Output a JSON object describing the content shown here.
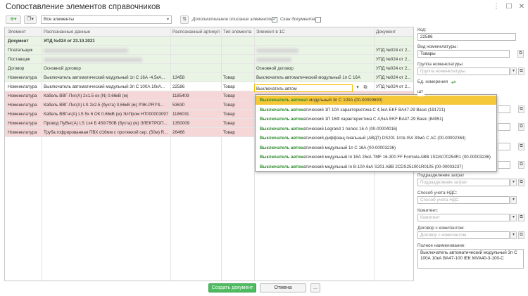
{
  "window": {
    "title": "Сопоставление элементов справочников"
  },
  "toolbar": {
    "filter_value": "Все элементы",
    "additional_descriptions_label": "Дополнительное описание элементов:",
    "scan_label": "Скан документа:"
  },
  "table": {
    "headers": [
      "Элемент",
      "Распознанные данные",
      "Распознанный артикул",
      "Тип элемента",
      "Элемент в 1С",
      "Документ"
    ],
    "rows": [
      {
        "color": "green",
        "element": "Документ",
        "data": "УПД №024 от 23.10.2021",
        "article": "",
        "type": "",
        "elem1c": "",
        "doc": "",
        "bold": true
      },
      {
        "color": "green",
        "element": "Плательщик",
        "data": "",
        "article": "",
        "type": "",
        "elem1c": "",
        "doc": "УПД №024 от 2..."
      },
      {
        "color": "green",
        "element": "Поставщик",
        "data": "",
        "article": "",
        "type": "",
        "elem1c": "",
        "doc": "УПД №024 от 2..."
      },
      {
        "color": "green",
        "element": "Договор",
        "data": "Основной договор",
        "article": "",
        "type": "",
        "elem1c": "Основной договор",
        "doc": "УПД №024 от 2..."
      },
      {
        "color": "green",
        "element": "Номенклатура",
        "data": "Выключатель автоматический модульный 1п С 16А -4,5кА...",
        "article": "13458",
        "type": "Товар",
        "elem1c": "Выключатель автоматический модульный 1п С 16А",
        "doc": "УПД №024 от 2..."
      },
      {
        "color": "white",
        "element": "Номенклатура",
        "data": "Выключатель автоматический модульный 3п С 100А 10кА...",
        "article": "22586",
        "type": "Товар",
        "elem1c": "",
        "doc": "УПД №024 от 2..."
      },
      {
        "color": "pink",
        "element": "Номенклатура",
        "data": "Кабель ВВГ-Пнг(А) 2х1.5 ок (N) 0.66кВ (м)",
        "article": "1185409",
        "type": "Товар",
        "elem1c": "",
        "doc": ""
      },
      {
        "color": "pink",
        "element": "Номенклатура",
        "data": "Кабель ВВГ-Пнг(А) LS 2х2.5 (бухта) 0,66кВ (м) РЭК-PRYS...",
        "article": "53630",
        "type": "Товар",
        "elem1c": "",
        "doc": ""
      },
      {
        "color": "pink",
        "element": "Номенклатура",
        "data": "Кабель ВВГнг(А) LS 5х 6 ОК 0.66кВ (м) ЭлПром НТ000003097",
        "article": "1186031",
        "type": "Товар",
        "elem1c": "",
        "doc": ""
      },
      {
        "color": "pink",
        "element": "Номенклатура",
        "data": "Провод ПуВнг(А) LS 1х4 Б 450/750В (бухта) (м) ЭЛЕКТРОП...",
        "article": "1350009",
        "type": "Товар",
        "elem1c": "",
        "doc": ""
      },
      {
        "color": "pink",
        "element": "Номенклатура",
        "data": "Труба гофрированная ПВХ d16мм с протяжкой сер. (50м) R...",
        "article": "26466",
        "type": "Товар",
        "elem1c": "",
        "doc": ""
      }
    ],
    "editing_value": "Выключатель автом"
  },
  "dropdown": {
    "match": "Выключатель автомат",
    "items": [
      {
        "match": "Выключатель автомат",
        "rest": " модульный 3п С 100А (00-00009690)"
      },
      {
        "match": "Выключатель автом",
        "rest": "атический 1П 10А характеристика С 4,5кА EKF BA47-29 Basic (191721)"
      },
      {
        "match": "Выключатель автом",
        "rest": "атический 1П 16Ф характеристика С 4,5кА EKF BA47-29 Basic (84951)"
      },
      {
        "match": "Выключатель автом",
        "rest": "атический Legrand 1 полюс 16 А (00-00004016)"
      },
      {
        "match": "Выключатель автом",
        "rest": "атический диффзащ пиальный (АВДТ) DS201 1птв ISA 30мА С АС (00-00002363)"
      },
      {
        "match": "Выключатель автом",
        "rest": "атический модульный 1п С 16А (00-00003236)"
      },
      {
        "match": "Выключатель автом",
        "rest": "атический модульный In 16А 25кА TMF 16-300 FF Formula ABB 1SDA070254R1 (00-00003236)"
      },
      {
        "match": "Выключатель автом",
        "rest": "атический модульный In B-10A 6кА S201 ABB 2CDS251001R0105 (00-00003237)"
      }
    ]
  },
  "right_panel": {
    "code_label": "Код:",
    "code_value": "22586",
    "kind_label": "Вид номенклатуры:",
    "kind_value": "Товары",
    "group_label": "Группа номенклатуры:",
    "group_placeholder": "Группа номенклатуры",
    "unit_label": "Ед. измерения",
    "unit_value": "шт",
    "division_label": "Подразделение затрат",
    "division_placeholder": "Подразделение затрат",
    "vat_label": "Способ учета НДС:",
    "vat_placeholder": "Способ учета НДС",
    "agent_label": "Комитент:",
    "agent_placeholder": "Комитент",
    "contract_label": "Договор с комитентом:",
    "contract_placeholder": "Договор с комитентом",
    "fullname_label": "Полное наименование:",
    "fullname_value": "Выключатель автоматический модульный 3п С 100А 10кА ВА47-100 IEK MVA40-3-100-С"
  },
  "footer": {
    "create_label": "Создать документ",
    "cancel_label": "Отмена",
    "more_label": "..."
  }
}
